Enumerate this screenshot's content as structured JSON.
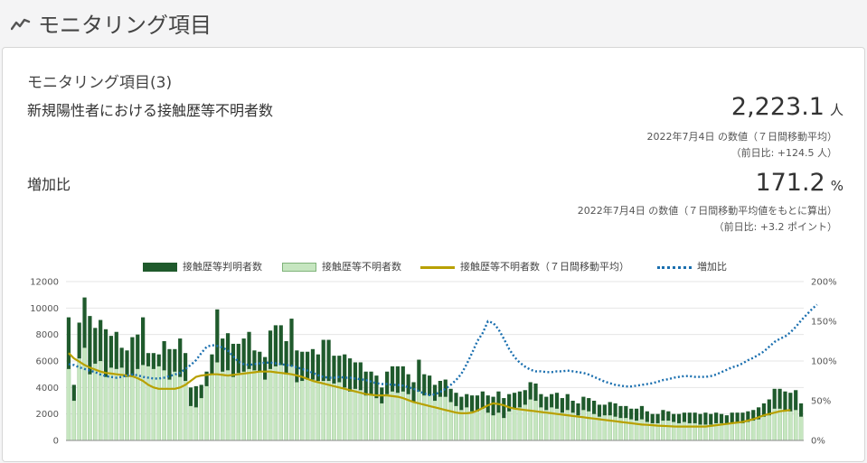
{
  "header": {
    "title": "モニタリング項目",
    "icon": "trend-line-icon"
  },
  "card": {
    "title": "モニタリング項目(3)",
    "subtitle": "新規陽性者における接触歴等不明者数",
    "main_value": "2,223.1",
    "main_unit": "人",
    "main_note": "2022年7月4日 の数値（７日間移動平均）",
    "main_diff": "（前日比: +124.5 人）",
    "ratio_label": "増加比",
    "ratio_value": "171.2",
    "ratio_unit": "%",
    "ratio_note": "2022年7月4日 の数値（７日間移動平均値をもとに算出）",
    "ratio_diff": "（前日比: +3.2 ポイント）"
  },
  "colors": {
    "known": "#1f5a2c",
    "unknown": "#c6e6c0",
    "unknown_border": "#7fb37a",
    "avg": "#b8a000",
    "ratio": "#1a6faf"
  },
  "chart_data": {
    "type": "bar",
    "legend": [
      "接触歴等判明者数",
      "接触歴等不明者数",
      "接触歴等不明者数（７日間移動平均）",
      "増加比"
    ],
    "y_left": {
      "ticks": [
        "0",
        "2000",
        "4000",
        "6000",
        "8000",
        "10000",
        "12000"
      ],
      "ylim": [
        0,
        12000
      ]
    },
    "y_right": {
      "ticks": [
        "0%",
        "50%",
        "100%",
        "150%",
        "200%"
      ],
      "ylim": [
        0,
        200
      ]
    },
    "series": [
      {
        "name": "接触歴等判明者数",
        "values": [
          3900,
          1200,
          2700,
          3800,
          4400,
          2700,
          3100,
          3600,
          2400,
          2800,
          1500,
          2000,
          2900,
          2600,
          3600,
          1000,
          1200,
          900,
          2200,
          2300,
          1700,
          2900,
          2100,
          1400,
          1600,
          1000,
          1100,
          1500,
          4000,
          2500,
          2800,
          2500,
          2200,
          2500,
          2800,
          1500,
          1500,
          1700,
          2900,
          3100,
          3000,
          2500,
          3600,
          2400,
          2200,
          2100,
          2300,
          2000,
          3100,
          3100,
          2100,
          2000,
          2500,
          2500,
          2000,
          2100,
          1800,
          1700,
          1700,
          1200,
          1700,
          1900,
          2000,
          1900,
          1500,
          1500,
          2400,
          1600,
          1500,
          1200,
          1200,
          1300,
          1000,
          1000,
          1000,
          1000,
          1200,
          1200,
          1300,
          1300,
          1400,
          1600,
          1500,
          1300,
          1200,
          1200,
          1100,
          1300,
          1300,
          1000,
          1000,
          1000,
          1200,
          1100,
          1200,
          900,
          900,
          1000,
          1000,
          1000,
          900,
          800,
          1000,
          1000,
          900,
          900,
          800,
          900,
          1000,
          800,
          700,
          700,
          800,
          700,
          600,
          700,
          700,
          800,
          800,
          800,
          900,
          800,
          800,
          700,
          700,
          800,
          800,
          800,
          800,
          800,
          900,
          1000,
          1200,
          1500,
          1500,
          1400,
          1400,
          1500,
          1000
        ]
      },
      {
        "name": "接触歴等不明者数",
        "values": [
          5400,
          3000,
          6200,
          7000,
          5000,
          5800,
          6000,
          4800,
          5500,
          5400,
          5500,
          4800,
          4900,
          5400,
          5700,
          5600,
          5400,
          5600,
          5300,
          4600,
          5200,
          4800,
          4500,
          2600,
          2500,
          3200,
          4100,
          5000,
          5900,
          5200,
          5300,
          4800,
          5100,
          5200,
          5400,
          5300,
          5200,
          4600,
          5400,
          5600,
          5700,
          5000,
          5600,
          4400,
          4500,
          4600,
          4600,
          4500,
          4500,
          4500,
          4300,
          4400,
          4000,
          3700,
          3900,
          3800,
          3400,
          3500,
          3200,
          2800,
          3500,
          3700,
          3600,
          3700,
          3500,
          2900,
          3700,
          3400,
          3400,
          3000,
          3300,
          3300,
          2900,
          2600,
          2300,
          2500,
          2200,
          2200,
          2400,
          2100,
          1900,
          2100,
          1700,
          2200,
          2400,
          2500,
          2700,
          3100,
          3000,
          2500,
          2300,
          2500,
          2400,
          2100,
          2300,
          2100,
          1900,
          2300,
          2200,
          2000,
          1800,
          1900,
          1900,
          1800,
          1700,
          1700,
          1600,
          1500,
          1600,
          1400,
          1300,
          1300,
          1500,
          1500,
          1400,
          1300,
          1400,
          1300,
          1300,
          1200,
          1200,
          1200,
          1300,
          1300,
          1200,
          1300,
          1300,
          1300,
          1400,
          1500,
          1600,
          1800,
          1900,
          2400,
          2400,
          2300,
          2200,
          2300,
          1800
        ]
      },
      {
        "name": "接触歴等不明者数（７日間移動平均）",
        "values": [
          6600,
          6200,
          5950,
          5700,
          5500,
          5350,
          5200,
          5100,
          5050,
          5000,
          4950,
          4900,
          4850,
          4700,
          4500,
          4200,
          4000,
          3900,
          3900,
          3900,
          3900,
          4000,
          4200,
          4500,
          4800,
          4900,
          4950,
          5000,
          5000,
          4950,
          4900,
          4950,
          5000,
          5050,
          5100,
          5150,
          5200,
          5200,
          5200,
          5150,
          5100,
          5050,
          5000,
          4900,
          4800,
          4650,
          4500,
          4400,
          4300,
          4200,
          4100,
          4000,
          3900,
          3800,
          3700,
          3600,
          3500,
          3450,
          3400,
          3400,
          3400,
          3350,
          3300,
          3200,
          3050,
          2900,
          2800,
          2700,
          2600,
          2500,
          2400,
          2300,
          2200,
          2100,
          2050,
          2050,
          2100,
          2250,
          2450,
          2650,
          2800,
          2750,
          2650,
          2500,
          2400,
          2350,
          2300,
          2250,
          2200,
          2150,
          2100,
          2050,
          2000,
          1950,
          1900,
          1850,
          1800,
          1750,
          1700,
          1650,
          1600,
          1550,
          1500,
          1450,
          1400,
          1350,
          1300,
          1250,
          1200,
          1180,
          1150,
          1120,
          1100,
          1080,
          1060,
          1050,
          1050,
          1050,
          1050,
          1050,
          1050,
          1100,
          1150,
          1200,
          1250,
          1300,
          1350,
          1400,
          1500,
          1600,
          1750,
          1900,
          2000,
          2100,
          2200,
          2250,
          2300
        ]
      },
      {
        "name": "増加比",
        "values": [
          96,
          95,
          92,
          90,
          88,
          86,
          83,
          81,
          80,
          79,
          80,
          82,
          83,
          82,
          80,
          79,
          78,
          78,
          79,
          81,
          83,
          85,
          90,
          95,
          101,
          110,
          118,
          120,
          119,
          117,
          113,
          106,
          99,
          96,
          95,
          96,
          97,
          98,
          98,
          97,
          96,
          95,
          94,
          92,
          90,
          88,
          85,
          82,
          80,
          79,
          79,
          80,
          79,
          79,
          78,
          77,
          76,
          74,
          72,
          71,
          71,
          70,
          70,
          69,
          67,
          65,
          62,
          59,
          57,
          58,
          61,
          65,
          70,
          76,
          84,
          96,
          110,
          125,
          135,
          150,
          148,
          140,
          128,
          115,
          105,
          98,
          93,
          89,
          87,
          87,
          86,
          86,
          87,
          87,
          88,
          87,
          86,
          85,
          83,
          80,
          77,
          74,
          72,
          70,
          69,
          68,
          68,
          69,
          70,
          71,
          72,
          74,
          76,
          77,
          79,
          80,
          81,
          81,
          80,
          80,
          80,
          81,
          83,
          86,
          89,
          92,
          94,
          97,
          101,
          104,
          108,
          112,
          118,
          124,
          128,
          131,
          136,
          143,
          151,
          158,
          165,
          171
        ]
      }
    ]
  }
}
